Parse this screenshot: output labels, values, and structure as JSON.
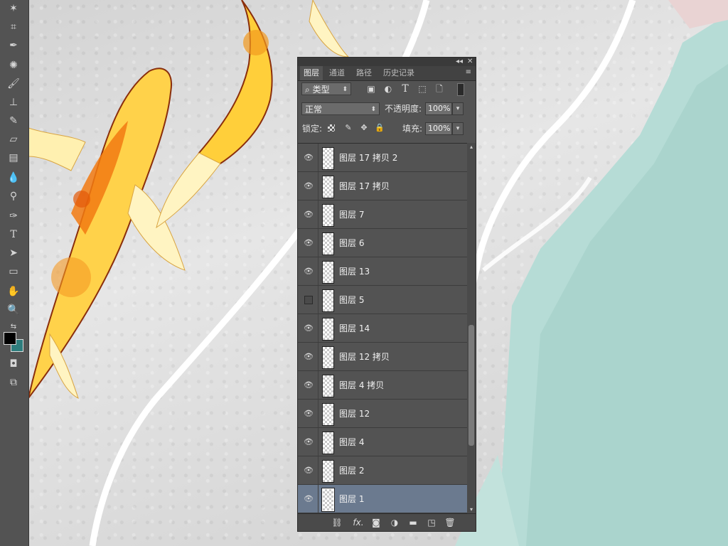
{
  "panel": {
    "tabs": [
      {
        "label": "图层",
        "active": true
      },
      {
        "label": "通道",
        "active": false
      },
      {
        "label": "路径",
        "active": false
      },
      {
        "label": "历史记录",
        "active": false
      }
    ],
    "window_controls": {
      "collapse": "◂◂",
      "close": "✕",
      "menu": "≡"
    },
    "filter": {
      "label": "类型",
      "icon": "search-icon"
    },
    "filter_icons": [
      "image-filter-icon",
      "adjustment-filter-icon",
      "type-filter-icon",
      "shape-filter-icon",
      "smart-object-filter-icon",
      "filter-toggle-icon"
    ],
    "blend_mode": "正常",
    "opacity": {
      "label": "不透明度:",
      "value": "100%"
    },
    "lock": {
      "label": "锁定:",
      "icons": [
        "lock-transparent-icon",
        "lock-paint-icon",
        "lock-position-icon",
        "lock-all-icon"
      ]
    },
    "fill": {
      "label": "填充:",
      "value": "100%"
    },
    "layers": [
      {
        "name": "图层 17 拷贝 2",
        "visible": true,
        "selected": false
      },
      {
        "name": "图层 17 拷贝",
        "visible": true,
        "selected": false
      },
      {
        "name": "图层 7",
        "visible": true,
        "selected": false
      },
      {
        "name": "图层 6",
        "visible": true,
        "selected": false
      },
      {
        "name": "图层 13",
        "visible": true,
        "selected": false
      },
      {
        "name": "图层 5",
        "visible": false,
        "selected": false
      },
      {
        "name": "图层 14",
        "visible": true,
        "selected": false
      },
      {
        "name": "图层 12 拷贝",
        "visible": true,
        "selected": false
      },
      {
        "name": "图层 4 拷贝",
        "visible": true,
        "selected": false
      },
      {
        "name": "图层 12",
        "visible": true,
        "selected": false
      },
      {
        "name": "图层 4",
        "visible": true,
        "selected": false
      },
      {
        "name": "图层 2",
        "visible": true,
        "selected": false
      },
      {
        "name": "图层 1",
        "visible": true,
        "selected": true
      }
    ],
    "bottom_icons": [
      "link-layers-icon",
      "fx-icon",
      "add-mask-icon",
      "adjustment-layer-icon",
      "new-group-icon",
      "new-layer-icon",
      "delete-layer-icon"
    ],
    "bottom_fx_label": "fx."
  },
  "tools": [
    "magic-wand-icon",
    "crop-icon",
    "eyedropper-icon",
    "spot-healing-icon",
    "brush-icon",
    "clone-stamp-icon",
    "history-brush-icon",
    "eraser-icon",
    "gradient-icon",
    "blur-icon",
    "dodge-icon",
    "pen-icon",
    "type-icon",
    "path-selection-icon",
    "rectangle-icon",
    "hand-icon",
    "zoom-icon"
  ],
  "type_tool_label": "T",
  "colors": {
    "foreground": "#000000",
    "background": "#2e7d7d",
    "selected_layer": "#6b7a8f",
    "panel_bg": "#535353"
  }
}
